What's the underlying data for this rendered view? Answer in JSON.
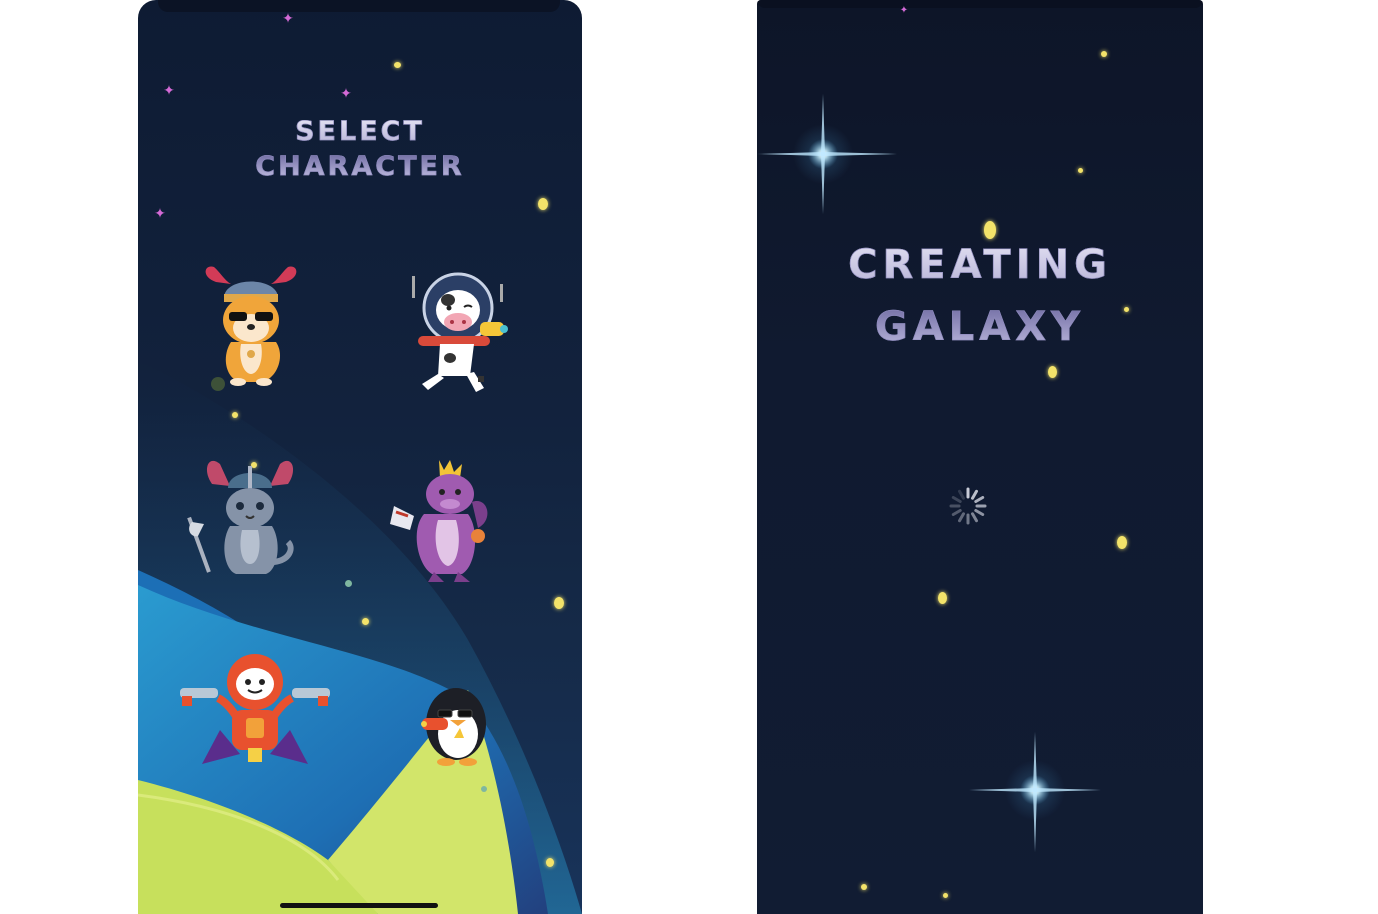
{
  "select_screen": {
    "title_line1": "SELECT",
    "title_line2": "CHARACTER",
    "characters": [
      {
        "name": "viking-corgi"
      },
      {
        "name": "astronaut-cow"
      },
      {
        "name": "viking-cat"
      },
      {
        "name": "dragon-king"
      },
      {
        "name": "robot-hero"
      },
      {
        "name": "penguin-gunner"
      }
    ]
  },
  "galaxy_screen": {
    "title_line1": "CREATING",
    "title_line2": "GALAXY",
    "loading_icon": "spinner-icon"
  },
  "colors": {
    "space_bg": "#101a30",
    "planet_blue": "#1c86c0",
    "planet_green": "#c7e05c",
    "star_yellow": "#f3e36a",
    "sparkle_pink": "#d46ad6"
  }
}
